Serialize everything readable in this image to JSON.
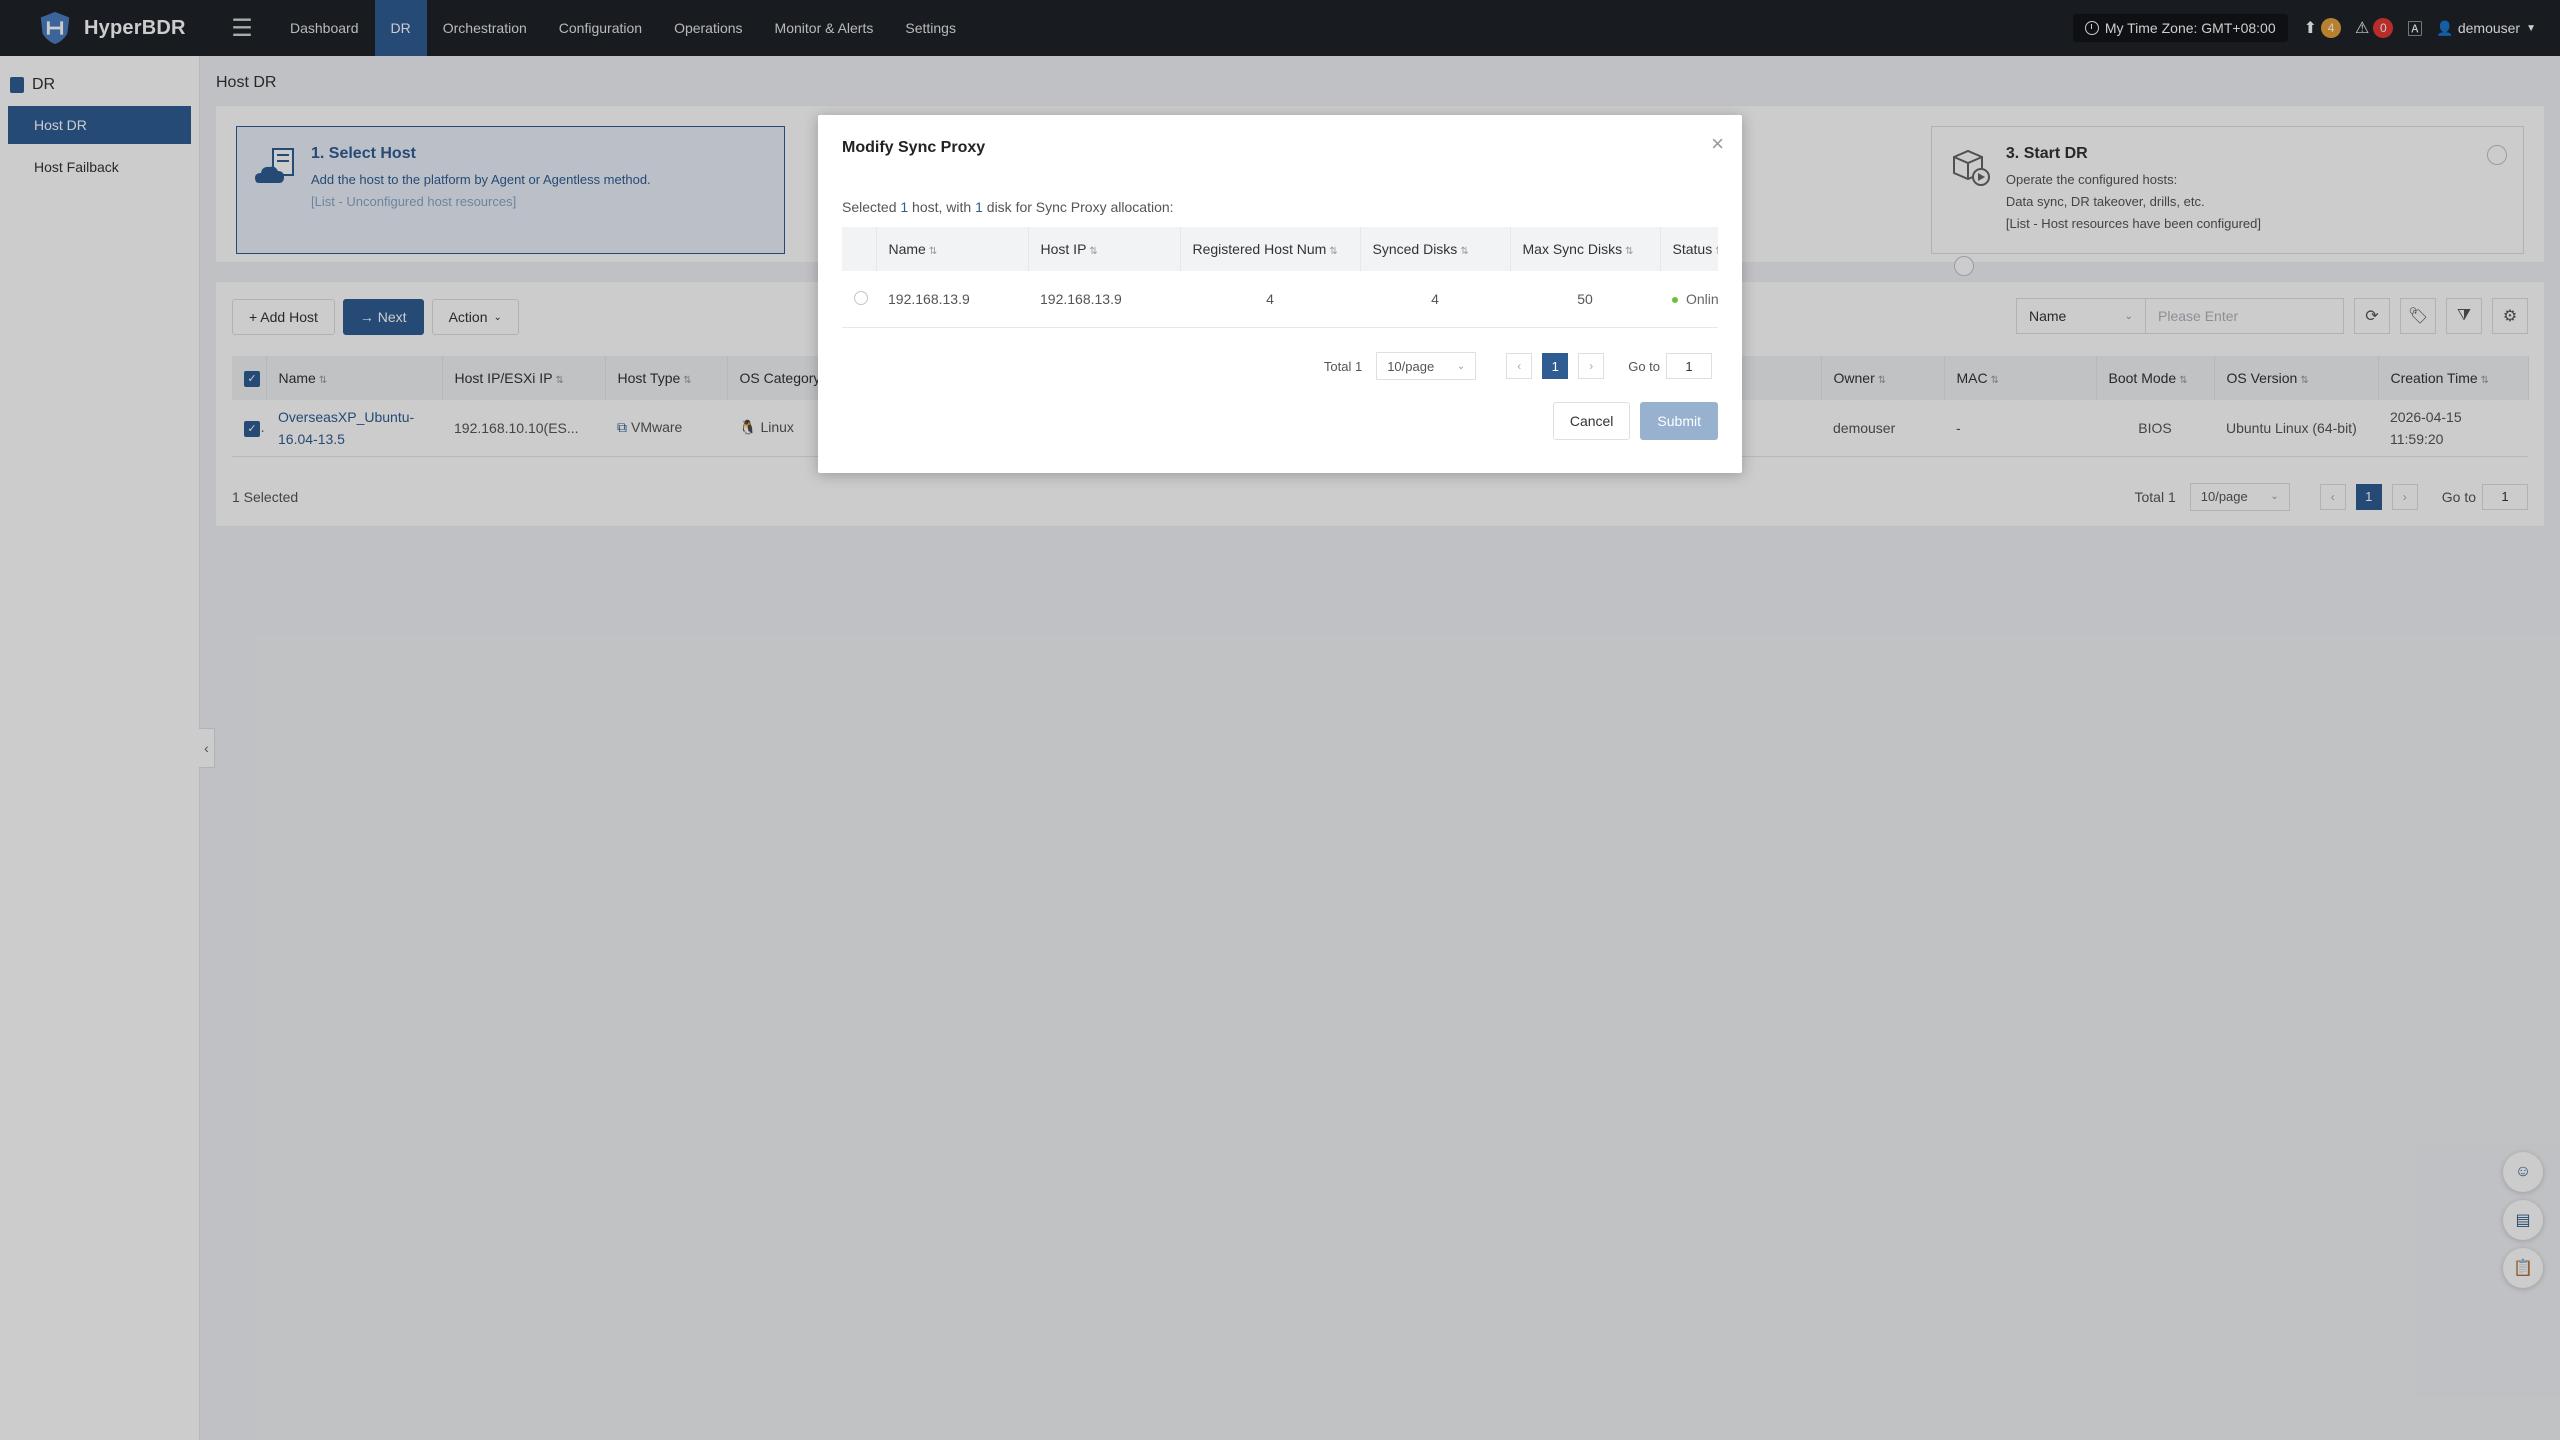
{
  "app": {
    "name": "HyperBDR"
  },
  "nav": {
    "items": [
      "Dashboard",
      "DR",
      "Orchestration",
      "Configuration",
      "Operations",
      "Monitor & Alerts",
      "Settings"
    ],
    "active": "DR"
  },
  "topbar": {
    "timezone": "My Time Zone: GMT+08:00",
    "upload_count": "4",
    "alert_count": "0",
    "user": "demouser"
  },
  "sidebar": {
    "group": "DR",
    "items": [
      {
        "label": "Host DR",
        "active": true
      },
      {
        "label": "Host Failback",
        "active": false
      }
    ]
  },
  "page": {
    "title": "Host DR"
  },
  "steps": {
    "s1": {
      "title": "1. Select Host",
      "desc": "Add the host to the platform by Agent or Agentless method.",
      "hint": "[List - Unconfigured host resources]"
    },
    "s3": {
      "title": "3. Start DR",
      "line1": "Operate the configured hosts:",
      "line2": "Data sync, DR takeover, drills, etc.",
      "hint": "[List - Host resources have been configured]"
    }
  },
  "toolbar": {
    "add_host": "+ Add Host",
    "next": "→ Next",
    "action": "Action",
    "filter_field": "Name",
    "search_placeholder": "Please Enter"
  },
  "host_table": {
    "columns": [
      "Name",
      "Host IP/ESXi IP",
      "Host Type",
      "OS Category",
      "Owner",
      "MAC",
      "Boot Mode",
      "OS Version",
      "Creation Time"
    ],
    "rows": [
      {
        "name": "OverseasXP_Ubuntu-16.04-13.5",
        "ip": "192.168.10.10(ES...",
        "type": "VMware",
        "os_category": "Linux",
        "owner": "demouser",
        "mac": "-",
        "boot_mode": "BIOS",
        "os_version": "Ubuntu Linux (64-bit)",
        "creation_time": "2026-04-15 11:59:20"
      }
    ],
    "selected_text": "1 Selected",
    "total": "Total 1",
    "page_size": "10/page",
    "page": "1",
    "goto_label": "Go to",
    "goto_value": "1"
  },
  "modal": {
    "title": "Modify Sync Proxy",
    "info_prefix": "Selected ",
    "info_hosts": "1",
    "info_mid": " host, with ",
    "info_disks": "1",
    "info_suffix": " disk for Sync Proxy allocation:",
    "columns": [
      "Name",
      "Host IP",
      "Registered Host Num",
      "Synced Disks",
      "Max Sync Disks",
      "Status"
    ],
    "rows": [
      {
        "name": "192.168.13.9",
        "host_ip": "192.168.13.9",
        "registered": "4",
        "synced": "4",
        "max_sync": "50",
        "status": "Online"
      }
    ],
    "total": "Total 1",
    "page_size": "10/page",
    "page": "1",
    "goto_label": "Go to",
    "goto_value": "1",
    "cancel": "Cancel",
    "submit": "Submit"
  },
  "colors": {
    "primary": "#2f5d93",
    "topbar": "#1f2228",
    "online": "#67c23a",
    "alert": "#e53935",
    "warning": "#e6a23c"
  }
}
